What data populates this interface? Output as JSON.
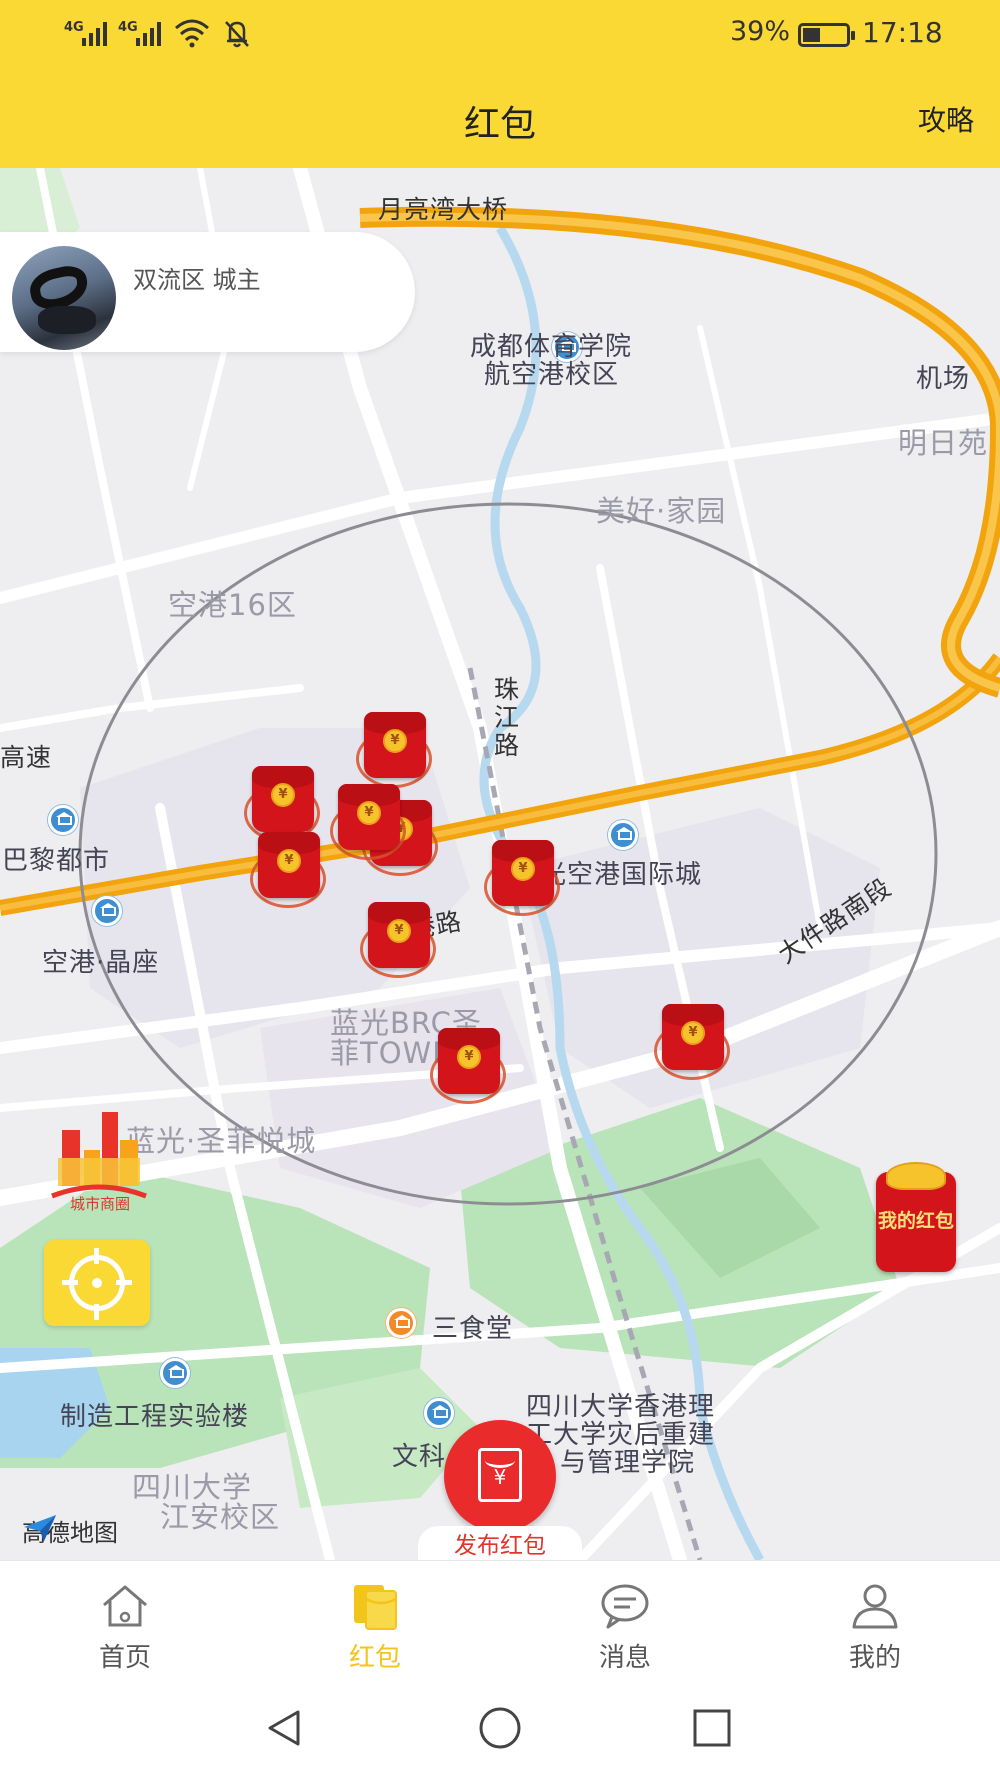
{
  "status_bar": {
    "signal1": "4G",
    "signal2": "4G",
    "battery_percent": "39%",
    "time": "17:18"
  },
  "header": {
    "title": "红包",
    "guide_label": "攻略"
  },
  "user_card": {
    "text": "双流区 城主"
  },
  "map_labels": {
    "bridge": "月亮湾大桥",
    "sports_school_1": "成都体育学院",
    "sports_school_2": "航空港校区",
    "airport_rd": "机场",
    "mingri": "明日苑",
    "meihao": "美好·家园",
    "konggang16": "空港16区",
    "highway": "高速",
    "zhujiang": "珠江路",
    "paris": "巴黎都市",
    "konggang_intl": "光空港国际城",
    "konggang_jingzuo": "空港·晶座",
    "gang_rd": "西港路",
    "brc_1": "蓝光BRC圣",
    "brc_2": "菲TOWN城",
    "dajian": "大件路南段",
    "lanyue": "蓝光·圣菲悦城",
    "canteen": "三食堂",
    "manufacturing": "制造工程实验楼",
    "hk_1": "四川大学香港理",
    "hk_2": "工大学灾后重建",
    "hk_3": "与管理学院",
    "wenke": "文科",
    "scu_1": "四川大学",
    "scu_2": "江安校区"
  },
  "map_logo": "高德地图",
  "left_controls": {
    "business_circle_label": "城市商圈"
  },
  "my_packets_label": "我的红包",
  "packet_symbol": "¥",
  "publish_label": "发布红包",
  "tabs": [
    {
      "label": "首页",
      "icon": "home-icon",
      "active": false
    },
    {
      "label": "红包",
      "icon": "red-packet-icon",
      "active": true
    },
    {
      "label": "消息",
      "icon": "message-icon",
      "active": false
    },
    {
      "label": "我的",
      "icon": "profile-icon",
      "active": false
    }
  ],
  "colors": {
    "accent_yellow": "#fbd935",
    "packet_red": "#d4141b",
    "active_tab": "#f3c51a"
  }
}
